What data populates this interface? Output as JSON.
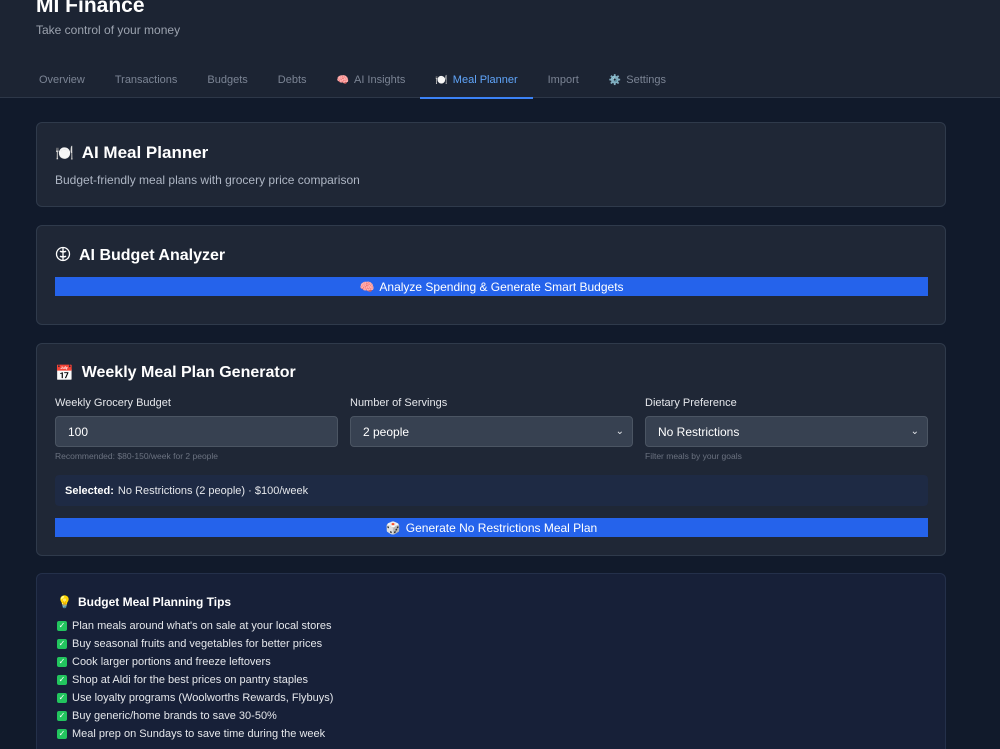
{
  "app": {
    "title": "MI Finance",
    "subtitle": "Take control of your money"
  },
  "tabs": [
    {
      "label": "Overview",
      "icon": "",
      "active": false
    },
    {
      "label": "Transactions",
      "icon": "",
      "active": false
    },
    {
      "label": "Budgets",
      "icon": "",
      "active": false
    },
    {
      "label": "Debts",
      "icon": "",
      "active": false
    },
    {
      "label": "AI Insights",
      "icon": "🧠",
      "active": false
    },
    {
      "label": "Meal Planner",
      "icon": "🍽️",
      "active": true
    },
    {
      "label": "Import",
      "icon": "",
      "active": false
    },
    {
      "label": "Settings",
      "icon": "⚙️",
      "active": false
    }
  ],
  "meal_planner": {
    "icon": "🍽️",
    "title": "AI Meal Planner",
    "description": "Budget-friendly meal plans with grocery price comparison"
  },
  "budget_analyzer": {
    "icon": "🧠",
    "title": "AI Budget Analyzer",
    "button_icon": "🧠",
    "button_label": "Analyze Spending & Generate Smart Budgets"
  },
  "generator": {
    "icon": "📅",
    "title": "Weekly Meal Plan Generator",
    "budget_label": "Weekly Grocery Budget",
    "budget_value": "100",
    "budget_hint": "Recommended: $80-150/week for 2 people",
    "servings_label": "Number of Servings",
    "servings_value": "2 people",
    "diet_label": "Dietary Preference",
    "diet_value": "No Restrictions",
    "diet_hint": "Filter meals by your goals",
    "selected_label": "Selected:",
    "selected_value": "No Restrictions (2 people) · $100/week",
    "button_icon": "🎲",
    "button_label": "Generate No Restrictions Meal Plan"
  },
  "tips": {
    "icon": "💡",
    "title": "Budget Meal Planning Tips",
    "items": [
      "Plan meals around what's on sale at your local stores",
      "Buy seasonal fruits and vegetables for better prices",
      "Cook larger portions and freeze leftovers",
      "Shop at Aldi for the best prices on pantry staples",
      "Use loyalty programs (Woolworths Rewards, Flybuys)",
      "Buy generic/home brands to save 30-50%",
      "Meal prep on Sundays to save time during the week"
    ]
  },
  "colors": {
    "accent": "#2563eb",
    "active_tab": "#60a5fa",
    "check": "#22c55e"
  }
}
